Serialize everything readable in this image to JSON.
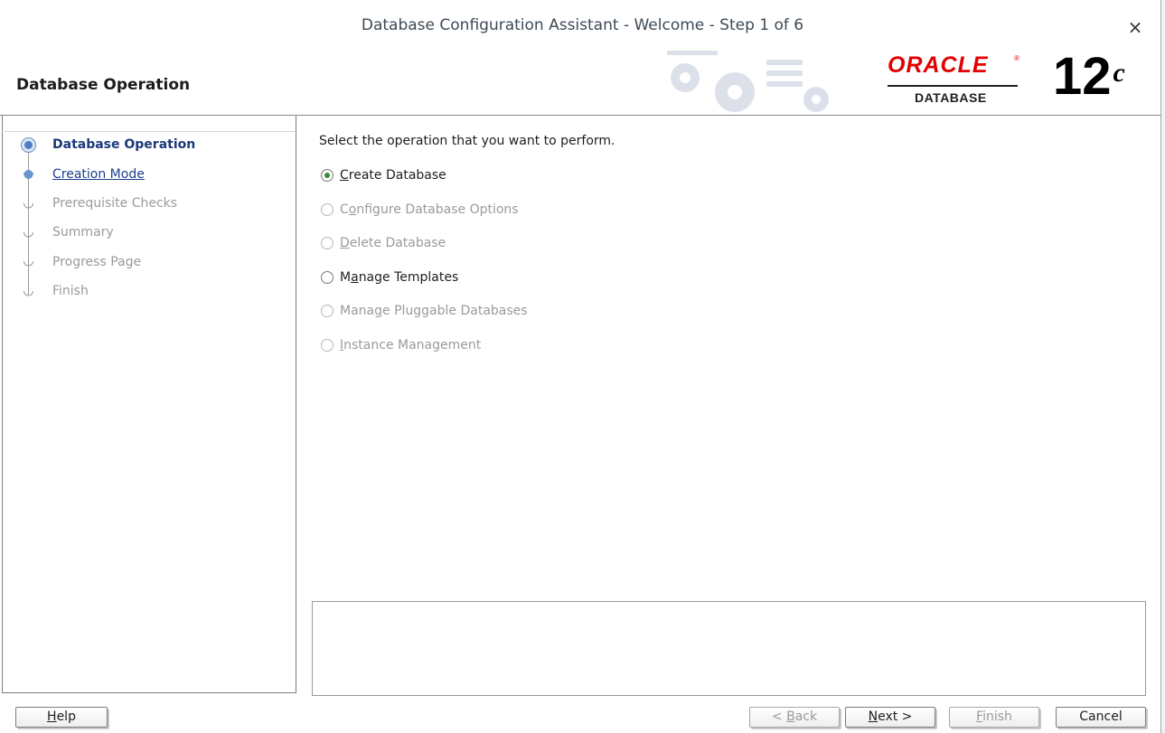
{
  "window": {
    "title": "Database Configuration Assistant - Welcome - Step 1 of 6",
    "close_glyph": "×"
  },
  "header": {
    "page_title": "Database Operation",
    "brand_word": "ORACLE",
    "brand_registered": "®",
    "brand_sub": "DATABASE",
    "version_number": "12",
    "version_suffix": "c",
    "brand_color": "#e30000"
  },
  "sidebar": {
    "steps": [
      {
        "label": "Database Operation",
        "state": "active"
      },
      {
        "label": "Creation Mode",
        "state": "link"
      },
      {
        "label": "Prerequisite Checks",
        "state": "disabled"
      },
      {
        "label": "Summary",
        "state": "disabled"
      },
      {
        "label": "Progress Page",
        "state": "disabled"
      },
      {
        "label": "Finish",
        "state": "disabled"
      }
    ]
  },
  "main": {
    "instruction": "Select the operation that you want to perform.",
    "options": [
      {
        "label": "Create Database",
        "mnemonic_before": "",
        "mnemonic": "C",
        "mnemonic_after": "reate Database",
        "selected": true,
        "enabled": true
      },
      {
        "label": "Configure Database Options",
        "mnemonic_before": "C",
        "mnemonic": "o",
        "mnemonic_after": "nfigure Database Options",
        "selected": false,
        "enabled": false
      },
      {
        "label": "Delete Database",
        "mnemonic_before": "",
        "mnemonic": "D",
        "mnemonic_after": "elete Database",
        "selected": false,
        "enabled": false
      },
      {
        "label": "Manage Templates",
        "mnemonic_before": "M",
        "mnemonic": "a",
        "mnemonic_after": "nage Templates",
        "selected": false,
        "enabled": true
      },
      {
        "label": "Manage Pluggable Databases",
        "mnemonic_before": "Mana",
        "mnemonic": "g",
        "mnemonic_after": "e Pluggable Databases",
        "selected": false,
        "enabled": false
      },
      {
        "label": "Instance Management",
        "mnemonic_before": "",
        "mnemonic": "I",
        "mnemonic_after": "nstance Management",
        "selected": false,
        "enabled": false
      }
    ],
    "message_text": ""
  },
  "footer": {
    "help": {
      "mnemonic": "H",
      "rest": "elp"
    },
    "back": {
      "prefix": "< ",
      "mnemonic": "B",
      "rest": "ack",
      "enabled": false
    },
    "next": {
      "mnemonic": "N",
      "rest": "ext >",
      "enabled": true
    },
    "finish": {
      "mnemonic": "F",
      "rest": "inish",
      "enabled": false
    },
    "cancel": {
      "label": "Cancel",
      "enabled": true
    }
  }
}
